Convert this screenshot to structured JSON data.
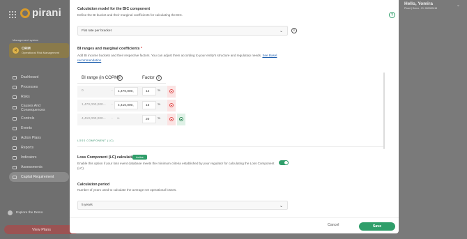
{
  "app": {
    "brand": "pirani",
    "management_label": "Management system",
    "module": {
      "badge": "R",
      "title": "ORM",
      "subtitle": "Operational Risk Management"
    },
    "nav": [
      {
        "label": "Dashboard",
        "icon": "dashboard-icon"
      },
      {
        "label": "Processes",
        "icon": "processes-icon"
      },
      {
        "label": "Risks",
        "icon": "risks-icon"
      },
      {
        "label": "Causes And Consequences",
        "icon": "causes-icon"
      },
      {
        "label": "Controls",
        "icon": "controls-icon"
      },
      {
        "label": "Events",
        "icon": "events-icon"
      },
      {
        "label": "Action Plans",
        "icon": "action-plans-icon"
      },
      {
        "label": "Reports",
        "icon": "reports-icon"
      },
      {
        "label": "Indicators",
        "icon": "indicators-icon"
      },
      {
        "label": "Assessments",
        "icon": "assessments-icon"
      },
      {
        "label": "Capital Requirement",
        "icon": "capital-icon",
        "active": true
      }
    ],
    "explore": "Explore the Demo",
    "view_plans": "View Plans",
    "user": {
      "name": "Hello, Yomira",
      "sub": "Pirani | Demo - ID: 000000416"
    }
  },
  "modal": {
    "calc_model": {
      "title": "Calculation model for the BIC component",
      "description": "Define the BI bucket and their marginal coefficients for calculating the BIC.",
      "selected": "Flat rate per bracket"
    },
    "bi_ranges": {
      "title": "BI ranges and marginal coefficients",
      "required_mark": "*",
      "description": "Add BI income buckets and their respective factors. You can adjust them according to your entity's structure and regulatory needs.",
      "link": "See Basel recommendation",
      "col_range": "BI range (in COPM)",
      "col_factor": "Factor",
      "rows": [
        {
          "from": "0",
          "to": "1,470,000,",
          "factor": "12",
          "unit": "%"
        },
        {
          "from": "1,470,000,000...",
          "to": "4,410,000,",
          "factor": "15",
          "unit": "%"
        },
        {
          "from": "4,410,000,000...",
          "to": "∞",
          "factor": "20",
          "unit": "%"
        }
      ]
    },
    "loss_component": {
      "section_label": "LOSS COMPONENT (LC)",
      "title": "Loss Component (LC) calculation",
      "badge": "Active",
      "description": "Enable this option if your loss event database meets the minimum criteria established by your regulator for calculating the Loss Component (LC)."
    },
    "calc_period": {
      "title": "Calculation period",
      "description": "Number of years used to calculate the average net operational losses.",
      "selected": "5 years"
    },
    "footer": {
      "cancel": "Cancel",
      "save": "Save"
    }
  }
}
